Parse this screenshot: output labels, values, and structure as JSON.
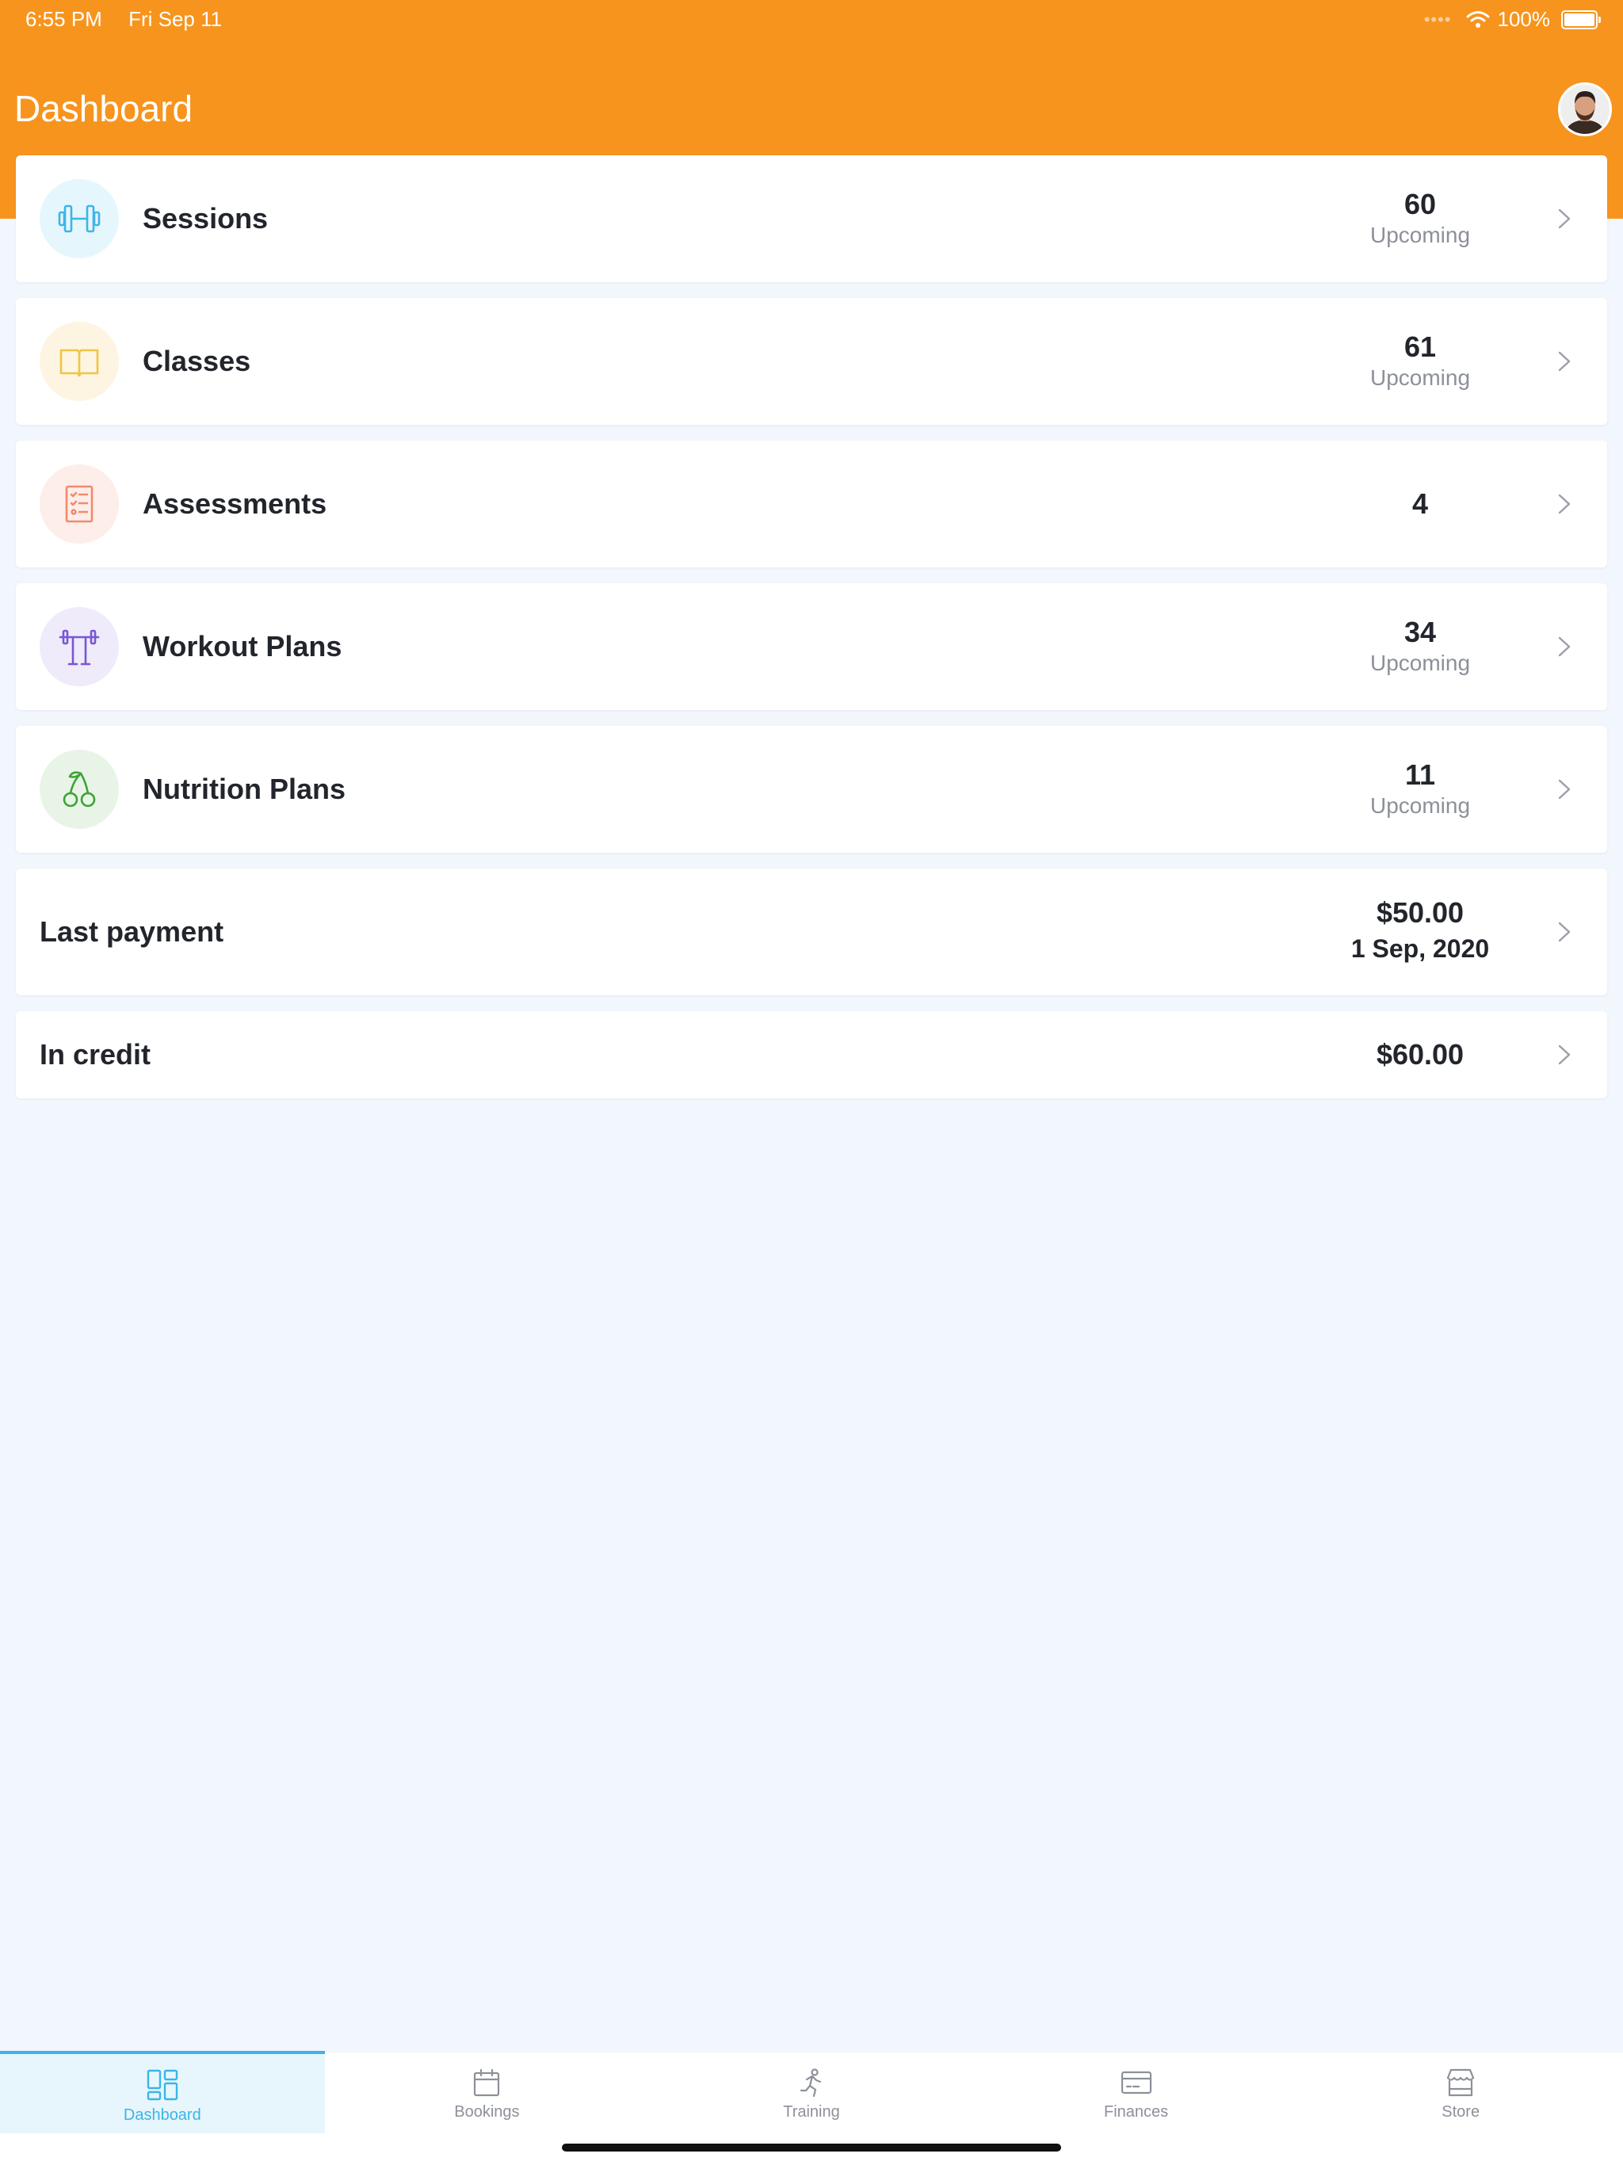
{
  "status_bar": {
    "time": "6:55 PM",
    "date": "Fri Sep 11",
    "battery": "100%",
    "icons": [
      "cellular-dots-icon",
      "wifi-icon",
      "battery-icon"
    ]
  },
  "header": {
    "title": "Dashboard",
    "background_color": "#f7941d",
    "avatar": "user-avatar"
  },
  "cards": [
    {
      "label": "Sessions",
      "value": "60",
      "sub": "Upcoming",
      "icon": "dumbbell-icon",
      "icon_color": "#3bb5e7",
      "icon_bg": "#e6f6fd"
    },
    {
      "label": "Classes",
      "value": "61",
      "sub": "Upcoming",
      "icon": "book-icon",
      "icon_color": "#f0c542",
      "icon_bg": "#fdf5e1"
    },
    {
      "label": "Assessments",
      "value": "4",
      "sub": "",
      "icon": "checklist-icon",
      "icon_color": "#f28a6b",
      "icon_bg": "#fdeeea"
    },
    {
      "label": "Workout Plans",
      "value": "34",
      "sub": "Upcoming",
      "icon": "barbell-rack-icon",
      "icon_color": "#7a55d6",
      "icon_bg": "#efebfb"
    },
    {
      "label": "Nutrition Plans",
      "value": "11",
      "sub": "Upcoming",
      "icon": "cherries-icon",
      "icon_color": "#3ca336",
      "icon_bg": "#e8f5e6"
    },
    {
      "label": "Last payment",
      "value": "$50.00",
      "sub": "1 Sep, 2020"
    },
    {
      "label": "In credit",
      "value": "$60.00",
      "sub": ""
    }
  ],
  "tabbar": {
    "active_color": "#3bb5e7",
    "tabs": [
      {
        "label": "Dashboard",
        "icon": "dashboard-grid-icon",
        "active": true
      },
      {
        "label": "Bookings",
        "icon": "calendar-icon",
        "active": false
      },
      {
        "label": "Training",
        "icon": "running-person-icon",
        "active": false
      },
      {
        "label": "Finances",
        "icon": "credit-card-icon",
        "active": false
      },
      {
        "label": "Store",
        "icon": "storefront-icon",
        "active": false
      }
    ]
  }
}
